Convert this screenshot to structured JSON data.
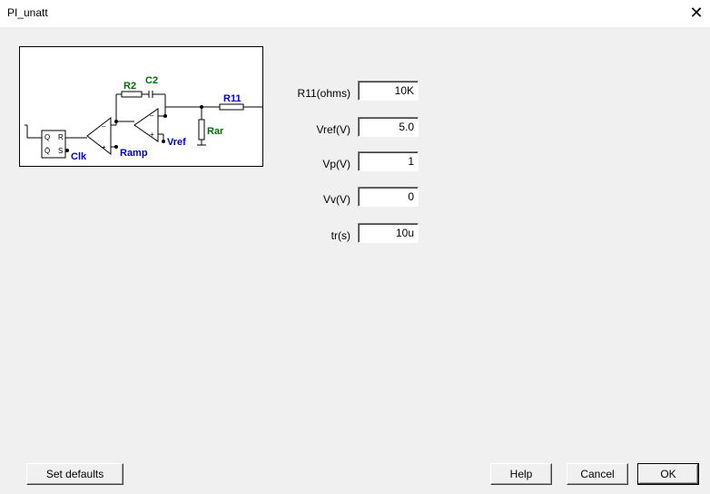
{
  "window": {
    "title": "PI_unatt"
  },
  "schematic": {
    "labels": {
      "r2": "R2",
      "c2": "C2",
      "r11": "R11",
      "rar": "Rar",
      "vref": "Vref",
      "ramp": "Ramp",
      "clk": "Clk",
      "q": "Q",
      "r": "R",
      "qbar": "Q̄",
      "s": "S",
      "minus": "–",
      "plus": "+"
    }
  },
  "fields": [
    {
      "label": "R11(ohms)",
      "value": "10K"
    },
    {
      "label": "Vref(V)",
      "value": "5.0"
    },
    {
      "label": "Vp(V)",
      "value": "1"
    },
    {
      "label": "Vv(V)",
      "value": "0"
    },
    {
      "label": "tr(s)",
      "value": "10u"
    }
  ],
  "buttons": {
    "set_defaults": "Set defaults",
    "help": "Help",
    "cancel": "Cancel",
    "ok": "OK"
  }
}
